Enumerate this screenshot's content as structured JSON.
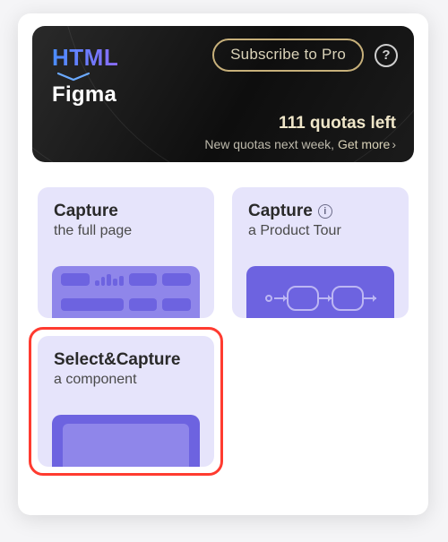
{
  "hero": {
    "brand_top": "HTML",
    "brand_bottom": "Figma",
    "subscribe_label": "Subscribe to Pro",
    "quota_count": "111 quotas left",
    "quota_sub_prefix": "New quotas next week, ",
    "quota_more": "Get more",
    "chevron": "›"
  },
  "cards": {
    "full_page": {
      "title": "Capture",
      "subtitle": "the full page"
    },
    "tour": {
      "title": "Capture",
      "subtitle": "a Product Tour"
    },
    "component": {
      "title": "Select&Capture",
      "subtitle": "a component"
    }
  }
}
